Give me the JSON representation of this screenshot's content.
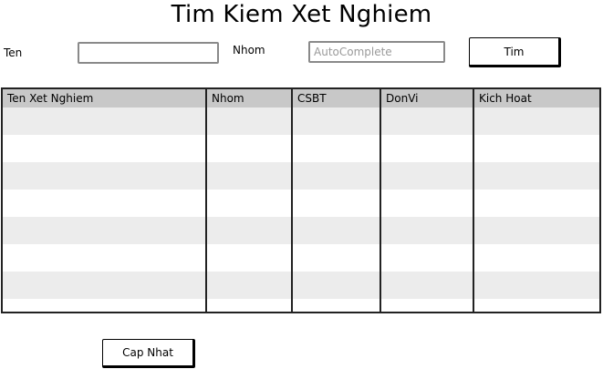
{
  "page": {
    "title": "Tim Kiem Xet Nghiem"
  },
  "search": {
    "ten_label": "Ten",
    "ten_value": "",
    "nhom_label": "Nhom",
    "nhom_placeholder": "AutoComplete",
    "search_button": "Tim"
  },
  "table": {
    "columns": [
      "Ten Xet Nghiem",
      "Nhom",
      "CSBT",
      "DonVi",
      "Kich Hoat"
    ],
    "rows": []
  },
  "footer": {
    "update_button": "Cap Nhat"
  }
}
